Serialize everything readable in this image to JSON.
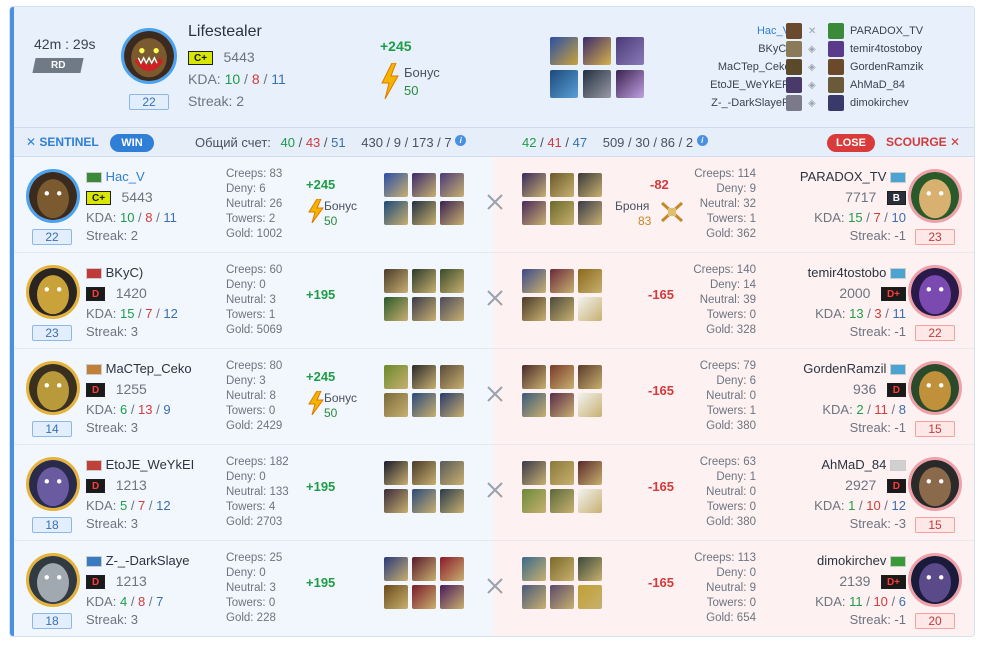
{
  "summary": {
    "time": "42m : 29s",
    "mode": "RD",
    "hero": "Lifestealer",
    "rank": "C+",
    "elo": "5443",
    "kda": {
      "k": "10",
      "d": "8",
      "a": "11"
    },
    "kda_label": "KDA:",
    "streak_label": "Streak:",
    "streak": "2",
    "level": "22",
    "gain": "+245",
    "bonus_label": "Бонус",
    "bonus_value": "50",
    "left_players": [
      "Hac_V",
      "BKyC)",
      "MaCTep_Cekc",
      "EtoJE_WeYkER",
      "Z-_-DarkSlayeR"
    ],
    "right_players": [
      "PARADOX_TV",
      "temir4tostoboy",
      "GordenRamzik",
      "AhMaD_84",
      "dimokirchev"
    ]
  },
  "teambar": {
    "sentinel": "SENTINEL",
    "win": "WIN",
    "score_label": "Общий счет:",
    "left_score": {
      "k": "40",
      "d": "43",
      "a": "51"
    },
    "left_extra": [
      "430",
      "9",
      "173",
      "7"
    ],
    "right_score": {
      "k": "42",
      "d": "41",
      "a": "47"
    },
    "right_extra": [
      "509",
      "30",
      "86",
      "2"
    ],
    "lose": "LOSE",
    "scourge": "SCOURGE"
  },
  "labels": {
    "creeps": "Creeps:",
    "deny": "Deny:",
    "neutral": "Neutral:",
    "towers": "Towers:",
    "gold": "Gold:",
    "kda": "KDA:",
    "streak": "Streak:",
    "bonus": "Бонус",
    "armor": "Броня"
  },
  "rows": [
    {
      "left": {
        "name": "Hac_V",
        "rank": "C+",
        "elo": "5443",
        "k": "10",
        "d": "8",
        "a": "11",
        "streak": "2",
        "level": "22",
        "creeps": "83",
        "deny": "6",
        "neutral": "26",
        "towers": "2",
        "gold": "1002",
        "gain": "+245",
        "bonus": "50"
      },
      "right": {
        "name": "PARADOX_TV",
        "rank": "B",
        "elo": "7717",
        "k": "15",
        "d": "7",
        "a": "10",
        "streak": "-1",
        "level": "23",
        "creeps": "114",
        "deny": "9",
        "neutral": "32",
        "towers": "1",
        "gold": "362",
        "loss": "-82",
        "armor": "83"
      }
    },
    {
      "left": {
        "name": "BKyC)",
        "rank": "D",
        "elo": "1420",
        "k": "15",
        "d": "7",
        "a": "12",
        "streak": "3",
        "level": "23",
        "creeps": "60",
        "deny": "0",
        "neutral": "3",
        "towers": "1",
        "gold": "5069",
        "gain": "+195"
      },
      "right": {
        "name": "temir4tostobo",
        "rank": "D+",
        "elo": "2000",
        "k": "13",
        "d": "3",
        "a": "11",
        "streak": "-1",
        "level": "22",
        "creeps": "140",
        "deny": "14",
        "neutral": "39",
        "towers": "0",
        "gold": "328",
        "loss": "-165"
      }
    },
    {
      "left": {
        "name": "MaCTep_Ceko",
        "rank": "D",
        "elo": "1255",
        "k": "6",
        "d": "13",
        "a": "9",
        "streak": "3",
        "level": "14",
        "creeps": "80",
        "deny": "3",
        "neutral": "8",
        "towers": "0",
        "gold": "2429",
        "gain": "+245",
        "bonus": "50"
      },
      "right": {
        "name": "GordenRamzil",
        "rank": "D",
        "elo": "936",
        "k": "2",
        "d": "11",
        "a": "8",
        "streak": "-1",
        "level": "15",
        "creeps": "79",
        "deny": "6",
        "neutral": "0",
        "towers": "1",
        "gold": "380",
        "loss": "-165"
      }
    },
    {
      "left": {
        "name": "EtoJE_WeYkEI",
        "rank": "D",
        "elo": "1213",
        "k": "5",
        "d": "7",
        "a": "12",
        "streak": "3",
        "level": "18",
        "creeps": "182",
        "deny": "0",
        "neutral": "133",
        "towers": "4",
        "gold": "2703",
        "gain": "+195"
      },
      "right": {
        "name": "AhMaD_84",
        "rank": "D",
        "elo": "2927",
        "k": "1",
        "d": "10",
        "a": "12",
        "streak": "-3",
        "level": "15",
        "creeps": "63",
        "deny": "1",
        "neutral": "0",
        "towers": "0",
        "gold": "380",
        "loss": "-165"
      }
    },
    {
      "left": {
        "name": "Z-_-DarkSlaye",
        "rank": "D",
        "elo": "1213",
        "k": "4",
        "d": "8",
        "a": "7",
        "streak": "3",
        "level": "18",
        "creeps": "25",
        "deny": "0",
        "neutral": "3",
        "towers": "0",
        "gold": "228",
        "gain": "+195"
      },
      "right": {
        "name": "dimokirchev",
        "rank": "D+",
        "elo": "2139",
        "k": "11",
        "d": "10",
        "a": "6",
        "streak": "-1",
        "level": "20",
        "creeps": "113",
        "deny": "0",
        "neutral": "9",
        "towers": "0",
        "gold": "654",
        "loss": "-165"
      }
    }
  ]
}
